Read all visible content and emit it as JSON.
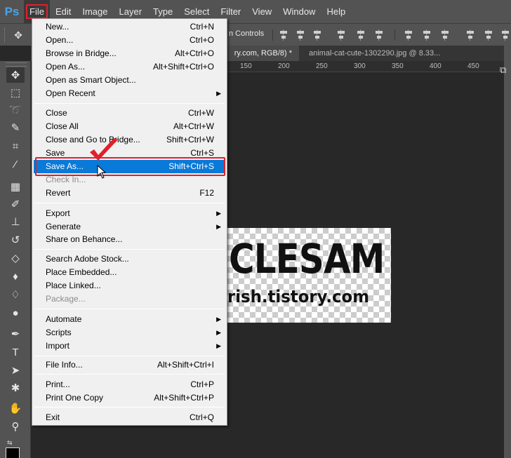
{
  "app": {
    "logo": "Ps"
  },
  "menubar": {
    "items": [
      {
        "label": "File"
      },
      {
        "label": "Edit"
      },
      {
        "label": "Image"
      },
      {
        "label": "Layer"
      },
      {
        "label": "Type"
      },
      {
        "label": "Select"
      },
      {
        "label": "Filter"
      },
      {
        "label": "View"
      },
      {
        "label": "Window"
      },
      {
        "label": "Help"
      }
    ]
  },
  "options": {
    "transform_label": "n Controls"
  },
  "tabs": {
    "active": "ry.com, RGB/8) *",
    "active_close": "×",
    "second": "animal-cat-cute-1302290.jpg @ 8.33..."
  },
  "ruler": {
    "n150": "150",
    "n200": "200",
    "n250": "250",
    "n300": "300",
    "n350": "350",
    "n400": "400",
    "n450": "450"
  },
  "canvas": {
    "title": "CLESAM",
    "url": "rish.tistory.com"
  },
  "file_menu": {
    "new": {
      "label": "New...",
      "shortcut": "Ctrl+N"
    },
    "open": {
      "label": "Open...",
      "shortcut": "Ctrl+O"
    },
    "browse_bridge": {
      "label": "Browse in Bridge...",
      "shortcut": "Alt+Ctrl+O"
    },
    "open_as": {
      "label": "Open As...",
      "shortcut": "Alt+Shift+Ctrl+O"
    },
    "open_smart": {
      "label": "Open as Smart Object..."
    },
    "open_recent": {
      "label": "Open Recent"
    },
    "close": {
      "label": "Close",
      "shortcut": "Ctrl+W"
    },
    "close_all": {
      "label": "Close All",
      "shortcut": "Alt+Ctrl+W"
    },
    "close_bridge": {
      "label": "Close and Go to Bridge...",
      "shortcut": "Shift+Ctrl+W"
    },
    "save": {
      "label": "Save",
      "shortcut": "Ctrl+S"
    },
    "save_as": {
      "label": "Save As...",
      "shortcut": "Shift+Ctrl+S"
    },
    "check_in": {
      "label": "Check In..."
    },
    "revert": {
      "label": "Revert",
      "shortcut": "F12"
    },
    "export": {
      "label": "Export"
    },
    "generate": {
      "label": "Generate"
    },
    "share_behance": {
      "label": "Share on Behance..."
    },
    "search_stock": {
      "label": "Search Adobe Stock..."
    },
    "place_embedded": {
      "label": "Place Embedded..."
    },
    "place_linked": {
      "label": "Place Linked..."
    },
    "package": {
      "label": "Package..."
    },
    "automate": {
      "label": "Automate"
    },
    "scripts": {
      "label": "Scripts"
    },
    "import": {
      "label": "Import"
    },
    "file_info": {
      "label": "File Info...",
      "shortcut": "Alt+Shift+Ctrl+I"
    },
    "print": {
      "label": "Print...",
      "shortcut": "Ctrl+P"
    },
    "print_one": {
      "label": "Print One Copy",
      "shortcut": "Alt+Shift+Ctrl+P"
    },
    "exit": {
      "label": "Exit",
      "shortcut": "Ctrl+Q"
    }
  },
  "colors": {
    "highlight": "#0a7ad8",
    "annotation_red": "#e0202c",
    "ps_blue": "#4aa3e8"
  }
}
